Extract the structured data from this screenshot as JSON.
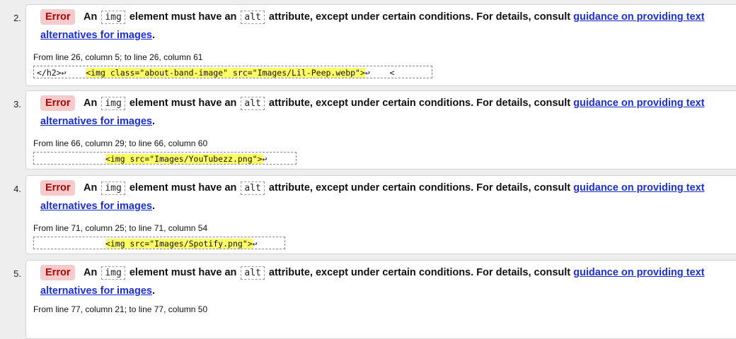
{
  "messages": [
    {
      "number": "2.",
      "badge": "Error",
      "text_a": "An",
      "code_a": "img",
      "text_b": "element must have an",
      "code_b": "alt",
      "text_c": "attribute, except under certain conditions. For details, consult",
      "link_part1": "guidance on providing text",
      "link_part2": "alternatives for images",
      "period": ".",
      "location": "From line 26, column 5; to line 26, column 61",
      "extract_before": "</h2>↩    ",
      "extract_highlight": "<img class=\"about-band-image\" src=\"Images/Lil-Peep.webp\">",
      "extract_after": "↩    <"
    },
    {
      "number": "3.",
      "badge": "Error",
      "text_a": "An",
      "code_a": "img",
      "text_b": "element must have an",
      "code_b": "alt",
      "text_c": "attribute, except under certain conditions. For details, consult",
      "link_part1": "guidance on providing text",
      "link_part2": "alternatives for images",
      "period": ".",
      "location": "From line 66, column 29; to line 66, column 60",
      "extract_before": "              ",
      "extract_highlight": "<img src=\"Images/YouTubezz.png\">",
      "extract_after": "↩        "
    },
    {
      "number": "4.",
      "badge": "Error",
      "text_a": "An",
      "code_a": "img",
      "text_b": "element must have an",
      "code_b": "alt",
      "text_c": "attribute, except under certain conditions. For details, consult",
      "link_part1": "guidance on providing text",
      "link_part2": "alternatives for images",
      "period": ".",
      "location": "From line 71, column 25; to line 71, column 54",
      "extract_before": "              ",
      "extract_highlight": "<img src=\"Images/Spotify.png\">",
      "extract_after": "↩        "
    },
    {
      "number": "5.",
      "badge": "Error",
      "text_a": "An",
      "code_a": "img",
      "text_b": "element must have an",
      "code_b": "alt",
      "text_c": "attribute, except under certain conditions. For details, consult",
      "link_part1": "guidance on providing text",
      "link_part2": "alternatives for images",
      "period": ".",
      "location": "From line 77, column 21; to line 77, column 50",
      "extract_before": "",
      "extract_highlight": "",
      "extract_after": ""
    }
  ]
}
